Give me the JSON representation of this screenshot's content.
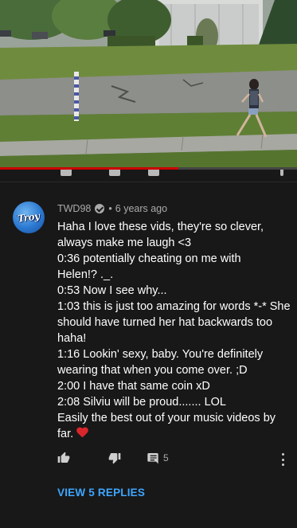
{
  "video": {
    "progress_fraction": 0.6
  },
  "comment": {
    "author": "TWD98",
    "age": "6 years ago",
    "avatar_text": "Troy",
    "lines": [
      "Haha I love these vids, they're so clever,",
      "always make me laugh <3",
      "0:36 potentially cheating on me with",
      "Helen!? ._.",
      "0:53 Now I see why...",
      "1:03 this is just too amazing for words *-* She",
      "should have turned her hat backwards too",
      "haha!",
      "1:16 Lookin' sexy, baby. You're definitely",
      "wearing that when you come over. ;D",
      "2:00 I have that same coin xD",
      "2:08 Silviu will be proud....... LOL",
      "Easily the best out of your music videos by",
      "far."
    ],
    "reply_count": "5",
    "view_replies_label": "VIEW 5 REPLIES"
  },
  "icons": {
    "like": "thumbs-up-icon",
    "dislike": "thumbs-down-icon",
    "reply": "reply-comment-icon",
    "more": "more-vert-icon",
    "verified": "verified-check-icon"
  },
  "colors": {
    "background": "#181818",
    "link": "#3ea6ff",
    "progress": "#cc0000",
    "heart": "#d9262c"
  }
}
